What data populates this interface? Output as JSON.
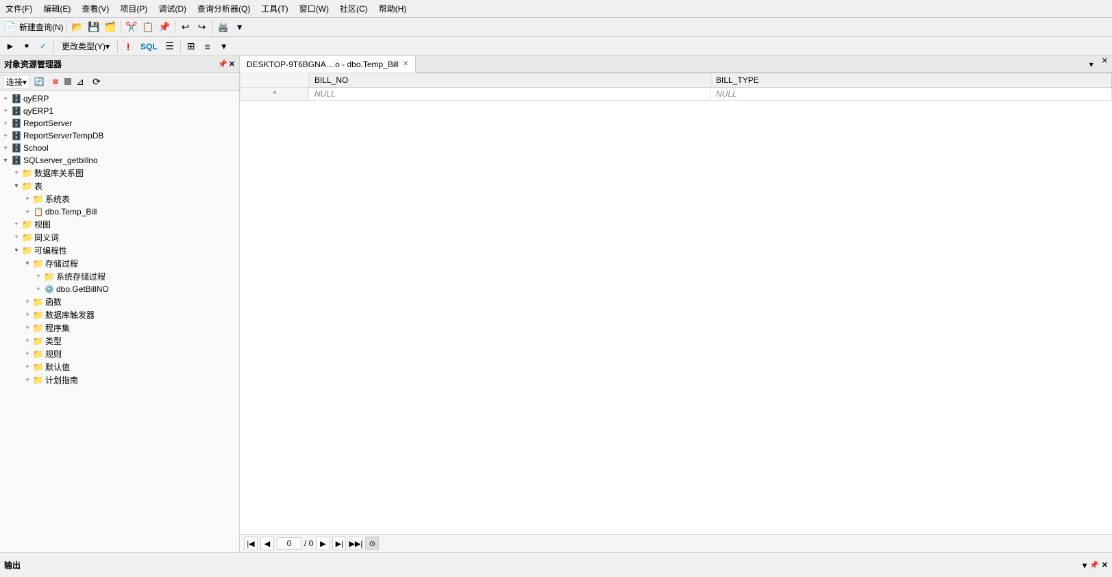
{
  "menubar": {
    "items": [
      "文件(F)",
      "编辑(E)",
      "查看(V)",
      "项目(P)",
      "调试(D)",
      "查询分析器(Q)",
      "工具(T)",
      "窗口(W)",
      "社区(C)",
      "帮助(H)"
    ]
  },
  "toolbar1": {
    "new_query": "新建查询(N)"
  },
  "toolbar2": {
    "change_type": "更改类型(Y)▾",
    "sql_label": "SQL"
  },
  "object_explorer": {
    "title": "对象资源管理器",
    "connect_label": "连接▾",
    "databases": [
      {
        "id": "qyERP",
        "label": "qyERP",
        "expanded": false,
        "level": 1
      },
      {
        "id": "qyERP1",
        "label": "qyERP1",
        "expanded": false,
        "level": 1
      },
      {
        "id": "ReportServer",
        "label": "ReportServer",
        "expanded": false,
        "level": 1
      },
      {
        "id": "ReportServerTempDB",
        "label": "ReportServerTempDB",
        "expanded": false,
        "level": 1
      },
      {
        "id": "School",
        "label": "School",
        "expanded": false,
        "level": 1
      },
      {
        "id": "SQLserver_getbillno",
        "label": "SQLserver_getbillno",
        "expanded": true,
        "level": 1,
        "children": [
          {
            "id": "dbdiagram",
            "label": "数据库关系图",
            "expanded": false,
            "level": 2,
            "type": "folder"
          },
          {
            "id": "tables",
            "label": "表",
            "expanded": true,
            "level": 2,
            "type": "folder",
            "children": [
              {
                "id": "systables",
                "label": "系统表",
                "expanded": false,
                "level": 3,
                "type": "folder"
              },
              {
                "id": "dbo_temp_bill",
                "label": "dbo.Temp_Bill",
                "expanded": false,
                "level": 3,
                "type": "table"
              }
            ]
          },
          {
            "id": "views",
            "label": "视图",
            "expanded": false,
            "level": 2,
            "type": "folder"
          },
          {
            "id": "synonyms",
            "label": "同义词",
            "expanded": false,
            "level": 2,
            "type": "folder"
          },
          {
            "id": "programmability",
            "label": "可编程性",
            "expanded": true,
            "level": 2,
            "type": "folder",
            "children": [
              {
                "id": "storedprocs",
                "label": "存储过程",
                "expanded": true,
                "level": 3,
                "type": "folder",
                "children": [
                  {
                    "id": "sysstoredprocs",
                    "label": "系统存储过程",
                    "expanded": false,
                    "level": 4,
                    "type": "folder"
                  },
                  {
                    "id": "dbo_getbillno",
                    "label": "dbo.GetBillNO",
                    "expanded": false,
                    "level": 4,
                    "type": "proc"
                  }
                ]
              },
              {
                "id": "functions",
                "label": "函数",
                "expanded": false,
                "level": 3,
                "type": "folder"
              },
              {
                "id": "triggers",
                "label": "数据库触发器",
                "expanded": false,
                "level": 3,
                "type": "folder"
              },
              {
                "id": "assemblies",
                "label": "程序集",
                "expanded": false,
                "level": 3,
                "type": "folder"
              },
              {
                "id": "types",
                "label": "类型",
                "expanded": false,
                "level": 3,
                "type": "folder"
              },
              {
                "id": "rules",
                "label": "规则",
                "expanded": false,
                "level": 3,
                "type": "folder"
              },
              {
                "id": "defaults",
                "label": "默认值",
                "expanded": false,
                "level": 3,
                "type": "folder"
              },
              {
                "id": "planquides",
                "label": "计划指南",
                "expanded": false,
                "level": 3,
                "type": "folder"
              }
            ]
          }
        ]
      }
    ]
  },
  "tab": {
    "label": "DESKTOP-9T6BGNA....o - dbo.Temp_Bill",
    "close_btn": "✕"
  },
  "grid": {
    "columns": [
      "BILL_NO",
      "BILL_TYPE"
    ],
    "row_marker": "*",
    "rows": [
      {
        "bill_no": "NULL",
        "bill_type": "NULL"
      }
    ]
  },
  "pagination": {
    "current_page": "0",
    "total_pages": "/ 0"
  },
  "output_panel": {
    "title": "输出"
  }
}
